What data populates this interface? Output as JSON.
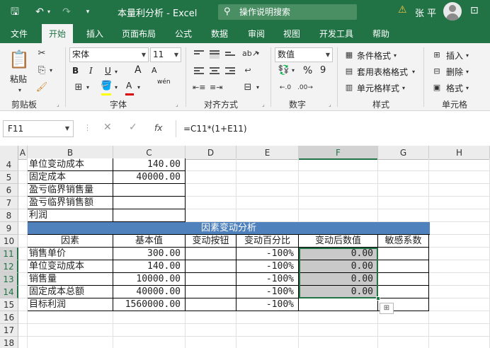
{
  "titlebar": {
    "title": "本量利分析  -  Excel",
    "search_placeholder": "操作说明搜索",
    "user_name": "张 平",
    "icons": [
      "save-icon",
      "undo-icon",
      "redo-icon",
      "customize-icon",
      "warning-icon",
      "avatar"
    ]
  },
  "tabs": [
    "文件",
    "开始",
    "插入",
    "页面布局",
    "公式",
    "数据",
    "审阅",
    "视图",
    "开发工具",
    "帮助"
  ],
  "active_tab": "开始",
  "ribbon": {
    "clipboard": {
      "label": "剪贴板",
      "paste": "粘贴"
    },
    "font": {
      "label": "字体",
      "name": "宋体",
      "size": "11",
      "wen": "wén",
      "a_up": "A",
      "a_down": "A",
      "bold": "B",
      "italic": "I",
      "underline": "U",
      "color_a": "A"
    },
    "alignment": {
      "label": "对齐方式"
    },
    "number": {
      "label": "数字",
      "format": "数值",
      "percent": "%",
      "comma": "9"
    },
    "styles": {
      "label": "样式",
      "conditional": "条件格式",
      "table": "套用表格格式",
      "cell": "单元格样式"
    },
    "cells": {
      "label": "单元格",
      "insert": "插入",
      "delete": "删除",
      "format": "格式"
    }
  },
  "formula_bar": {
    "name_box": "F11",
    "fx": "fx",
    "formula": "=C11*(1+E11)"
  },
  "columns": [
    "A",
    "B",
    "C",
    "D",
    "E",
    "F",
    "G",
    "H"
  ],
  "rows": [
    "4",
    "5",
    "6",
    "7",
    "8",
    "9",
    "10",
    "11",
    "12",
    "13",
    "14",
    "15",
    "16",
    "17",
    "18"
  ],
  "top_table": [
    [
      "单位变动成本",
      "140.00"
    ],
    [
      "固定成本",
      "40000.00"
    ],
    [
      "盈亏临界销售量",
      ""
    ],
    [
      "盈亏临界销售额",
      ""
    ],
    [
      "利润",
      ""
    ]
  ],
  "banner": "因素变动分析",
  "analysis_header": [
    "因素",
    "基本值",
    "变动按钮",
    "变动百分比",
    "变动后数值",
    "敏感系数"
  ],
  "analysis_rows": [
    [
      "销售单价",
      "300.00",
      "",
      "-100%",
      "0.00",
      ""
    ],
    [
      "单位变动成本",
      "140.00",
      "",
      "-100%",
      "0.00",
      ""
    ],
    [
      "销售量",
      "10000.00",
      "",
      "-100%",
      "0.00",
      ""
    ],
    [
      "固定成本总额",
      "40000.00",
      "",
      "-100%",
      "0.00",
      ""
    ],
    [
      "目标利润",
      "1560000.00",
      "",
      "-100%",
      "",
      ""
    ]
  ],
  "colors": {
    "excel_green": "#217346",
    "banner_blue": "#4f81bd",
    "selection_gray": "#c9c9c9"
  }
}
